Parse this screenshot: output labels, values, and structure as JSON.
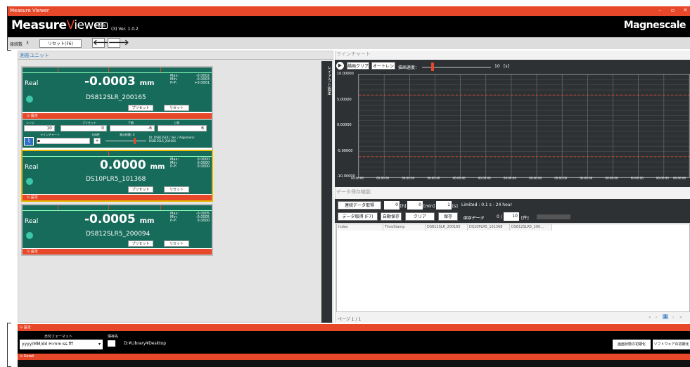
{
  "window": {
    "title": "Measure Viewer",
    "controls": [
      "–",
      "▫",
      "✕"
    ]
  },
  "header": {
    "logo_main": "Measure",
    "logo_v": "V",
    "logo_rest": "iewer",
    "lite": "Lite",
    "version": "(3) Ver. 1.0.2",
    "brand": "Magnescale"
  },
  "toolbar": {
    "connection_label": "接続数",
    "connection_count": "3",
    "reset_label": "リセット(F6)",
    "back_arrow": "🡐",
    "forward_arrow": "🡒"
  },
  "left_panel": {
    "title": "測長ユニット",
    "layout_label": "レイアウト設定"
  },
  "units": [
    {
      "mode": "Real",
      "value": "-0.0003",
      "unit": "mm",
      "max_label": "Max:",
      "min_label": "Min:",
      "pp_label": "P-P:",
      "max": "-0.0002",
      "min": "-0.0003",
      "pp": "+0.0001",
      "device": "DS812SLR_200165",
      "preset_label": "プリセット",
      "reset_label": "リセット",
      "settings_label": "設定",
      "expanded": true,
      "selected": false
    },
    {
      "mode": "Real",
      "value": "0.0000",
      "unit": "mm",
      "max_label": "Max:",
      "min_label": "Min:",
      "pp_label": "P-P:",
      "max": "0.0000",
      "min": "0.0000",
      "pp": "0.0000",
      "device": "DS10PLR5_101368",
      "preset_label": "プリセット",
      "reset_label": "リセット",
      "settings_label": "設定",
      "expanded": false,
      "selected": true
    },
    {
      "mode": "Real",
      "value": "-0.0005",
      "unit": "mm",
      "max_label": "Max:",
      "min_label": "Min:",
      "pp_label": "P-P:",
      "max": "-0.0005",
      "min": "-0.0005",
      "pp": "0.0000",
      "device": "DS812SLR5_200094",
      "preset_label": "プリセット",
      "reset_label": "リセット",
      "settings_label": "設定",
      "expanded": false,
      "selected": false
    }
  ],
  "unit_settings": {
    "range_label": "レンジ",
    "range_value": "10",
    "preset_label": "プリセット",
    "preset_value": "0",
    "lower_label": "下限",
    "lower_value": "-6",
    "upper_label": "上限",
    "upper_value": "6",
    "linechart_label": "ラインチャート",
    "direction_label": "方向性",
    "direction_value": "+",
    "decimals_label": "表示桁数: 4",
    "info": "ID: DS812SLR / Ver. / Alignment: DS812SLR_200165"
  },
  "line_chart": {
    "title": "ラインチャート",
    "clear_label": "描画クリア",
    "autorange_label": "オートレンジ",
    "speed_label": "描画速度：",
    "speed_value": "10",
    "speed_unit": "[s]",
    "speed_level": 0.15,
    "chart_data": {
      "type": "line",
      "ylim": [
        -10,
        10
      ],
      "yticks": [
        "10.00000",
        "5.00000",
        "0.00000",
        "-5.00000",
        "-10.00000"
      ],
      "x": [
        "00:00:00",
        "00:00:00",
        "00:00:00",
        "00:00:00",
        "00:00:00",
        "00:00:00",
        "00:00:00",
        "00:00:00",
        "00:00:00",
        "00:00:00",
        "00:00:00",
        "00:00:00",
        "00:00:00",
        "00:00:00"
      ],
      "limit_lines": [
        6,
        -6
      ],
      "grid": true,
      "series": []
    }
  },
  "data_save": {
    "title": "データ保存機能",
    "continuous_label": "連続データ取得",
    "h_value": "0",
    "h_unit": "[h]",
    "min_value": "0",
    "min_unit": "[min]",
    "s_value": "1",
    "s_unit": "[s]",
    "limited": "Limited : 0.1 s - 24 hour",
    "fetch_label": "データ取得 (F7)",
    "autosave_label": "自動保存",
    "clear_label": "クリア",
    "save_label": "保存",
    "saved_label": "保存データ",
    "saved_count": "0 /",
    "max_count": "10",
    "count_unit": "[件]"
  },
  "grid": {
    "columns": [
      "Index",
      "TimeStamp",
      "DS812SLR_200165",
      "DS10PLR5_101368",
      "DS812SLR5_200…"
    ],
    "rows": []
  },
  "pager": {
    "page_label": "ページ 1 / 1",
    "nav": [
      "«",
      "‹",
      "1",
      "›",
      "»"
    ]
  },
  "bottom": {
    "settings_label": "設定",
    "date_format_label": "日付フォーマット",
    "date_format_value": "yyyy/MM/dd H:mm:ss.fff",
    "save_to_label": "保存先",
    "save_path": "D:¥Library¥Desktop",
    "reset_screen_label": "画面状態の初期化",
    "reset_software_label": "ソフトウェアの初期化",
    "detail_label": "Detail"
  }
}
